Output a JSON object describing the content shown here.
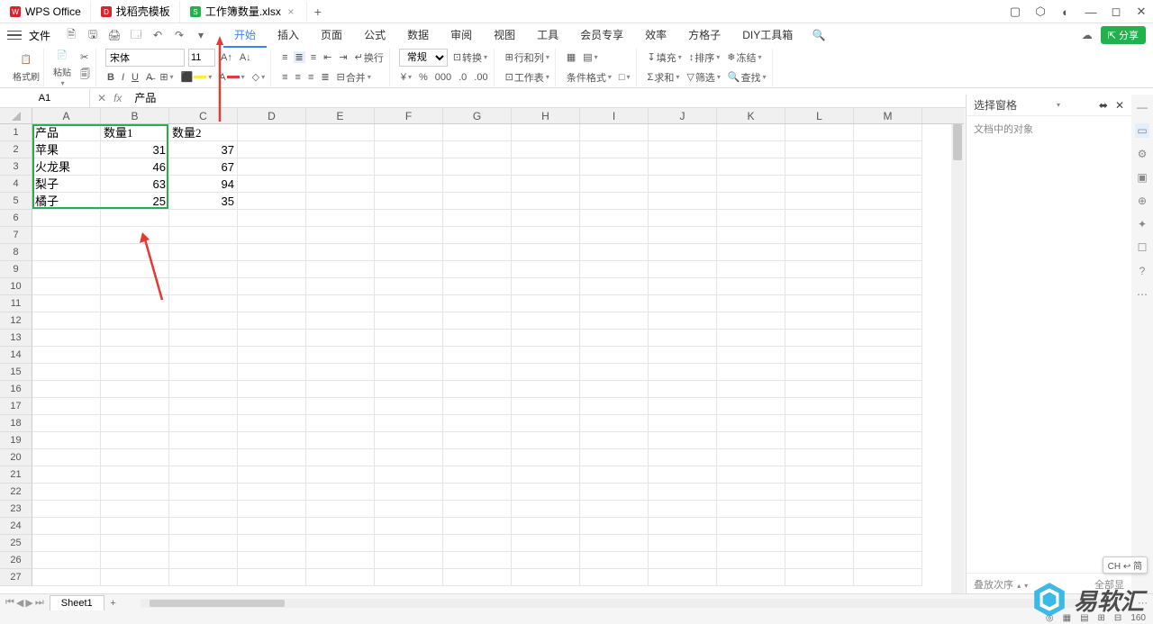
{
  "title_tabs": [
    {
      "label": "WPS Office",
      "icon_color": "#d9232e"
    },
    {
      "label": "找稻壳模板",
      "icon_color": "#d9232e"
    },
    {
      "label": "工作簿数量.xlsx",
      "icon_color": "#22b14c",
      "active": true,
      "closable": true
    }
  ],
  "file_menu": "文件",
  "menu_tabs": [
    "开始",
    "插入",
    "页面",
    "公式",
    "数据",
    "审阅",
    "视图",
    "工具",
    "会员专享",
    "效率",
    "方格子",
    "DIY工具箱"
  ],
  "active_menu_tab": 0,
  "share_label": "分享",
  "ribbon": {
    "format_painter": "格式刷",
    "paste": "粘贴",
    "font_name": "宋体",
    "font_size": "11",
    "wrap": "换行",
    "merge": "合并",
    "number_format": "常规",
    "convert": "转换",
    "rowcol": "行和列",
    "worksheet": "工作表",
    "cond_format": "条件格式",
    "fill": "填充",
    "sort": "排序",
    "freeze": "冻结",
    "sum": "求和",
    "filter": "筛选",
    "find": "查找"
  },
  "cell_ref": "A1",
  "formula_value": "产品",
  "columns": [
    "A",
    "B",
    "C",
    "D",
    "E",
    "F",
    "G",
    "H",
    "I",
    "J",
    "K",
    "L",
    "M"
  ],
  "rows": 27,
  "table": {
    "headers": [
      "产品",
      "数量1",
      "数量2"
    ],
    "data": [
      [
        "苹果",
        31,
        37
      ],
      [
        "火龙果",
        46,
        67
      ],
      [
        "梨子",
        63,
        94
      ],
      [
        "橘子",
        25,
        35
      ]
    ]
  },
  "selection": {
    "top_row": 1,
    "left_col": 0,
    "bottom_row": 5,
    "right_col": 1
  },
  "sheet_name": "Sheet1",
  "side_panel": {
    "title": "选择窗格",
    "subtitle": "文档中的对象",
    "stack_order": "叠放次序",
    "all_show": "全部显"
  },
  "status_zoom": "160",
  "badge": "CH ↩ 简",
  "watermark": "易软汇"
}
